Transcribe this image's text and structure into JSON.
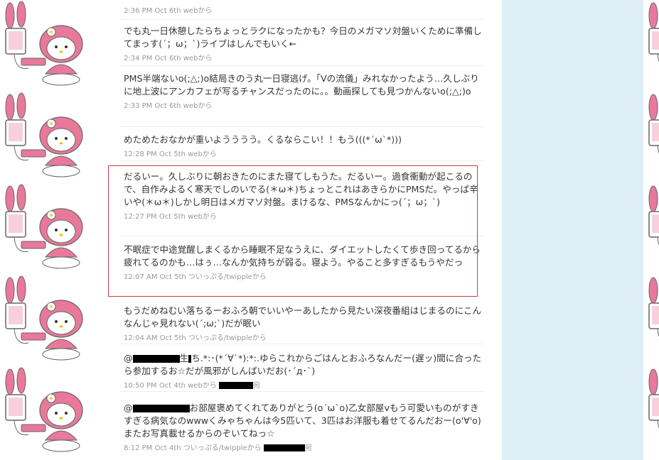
{
  "colors": {
    "sidebar_bg": "#ddeef6",
    "meta_text": "#999999",
    "highlight_border": "#c24040",
    "wallpaper_pink": "#e8799b"
  },
  "wallpaper": {
    "icon": "my-melody-character-icon"
  },
  "tweets": [
    {
      "text": "",
      "time": "2:36 PM Oct 6th",
      "source": "webから"
    },
    {
      "text": "でも丸一日休憩したらちょっとラクになったかも？今日のメガマソ対盤いくために準備してまっす(´；ω；`)ライブはしんでもいく←",
      "time": "2:34 PM Oct 6th",
      "source": "webから"
    },
    {
      "text": "PMS半端ないo(;△;)o結局きのう丸一日寝逃げ。「Vの流儀」みれなかったよう…久しぶりに地上波にアンカフェが写るチャンスだったのに。。動画探しても見つかんないo(;△;)o",
      "time": "2:33 PM Oct 6th",
      "source": "webから"
    },
    {
      "text": "めためたおなかが重いようううう。くるならこい！！もう(((*´ω`*)))",
      "time": "12:28 PM Oct 5th",
      "source": "webから"
    },
    {
      "text": "だるいー。久しぶりに朝おきたのにまた寝てしもうた。だるいー。過食衝動が起こるので、自作みよるく寒天でしのいでる(＊ω＊)ちょっとこれはあきらかにPMSだ。やっぱ辛いや(＊ω＊)しかし明日はメガマソ対盤。まけるな、PMSなんかにっ(´；ω；`)",
      "time": "12:27 PM Oct 5th",
      "source": "webから"
    },
    {
      "text": "不眠症で中途覚醒しまくるから睡眠不足なうえに、ダイエットしたくて歩き回ってるから疲れてるのかも…はぅ…なんか気持ちが弱る。寝よう。やること多すぎるもうやだっ",
      "time": "12:07 AM Oct 5th",
      "source": "ついっぷる/twippleから"
    },
    {
      "text": "もうだめねむい落ちるーおふろ朝でいいやーあしたから見たい深夜番組はじまるのにこんなんじゃ見れない(´;ω;`)だが眠い",
      "time": "12:04 AM Oct 5th",
      "source": "ついっぷる/twippleから"
    },
    {
      "prefix": "@",
      "text_a": "生",
      "text_b": "ち.*:･(*´∀`*):*:.ゆらこれからごはんとおふろなんだー(遅ッ)間に合ったら参加するお☆だが風邪がしんぱいだお(･´д･`)",
      "time": "10:50 PM Oct 4th",
      "source": "webから",
      "suffix": "宛"
    },
    {
      "prefix": "@",
      "text": "お部屋褒めてくれてありがとう(o´ω`o)乙女部屋vもう可愛いものがすきすぎる病気なのwwwくみゃちゃんは今5匹いて、3匹はお洋服も着せてるんだおー(o'∀'o)またお写真載せるからのぞいてねっ☆",
      "time": "8:12 PM Oct 4th",
      "source": "ついっぷる/twippleから",
      "suffix": "宛"
    }
  ]
}
